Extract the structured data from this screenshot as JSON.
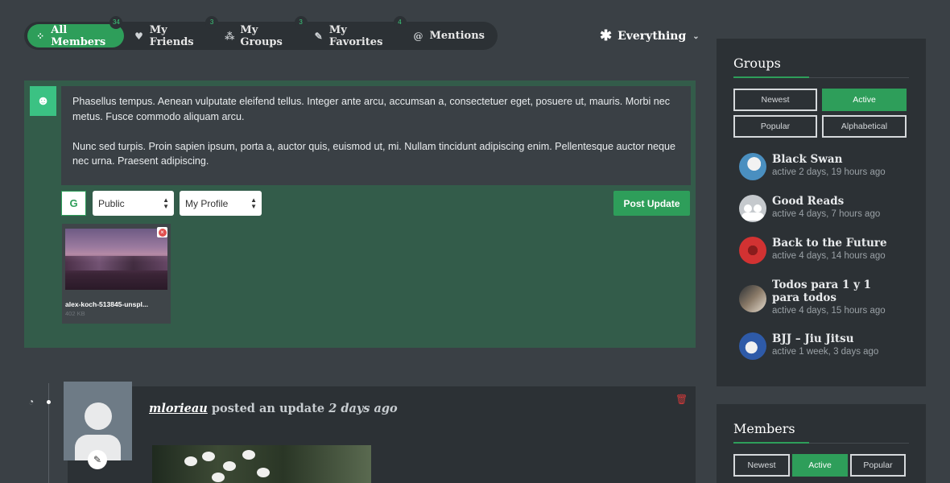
{
  "nav": {
    "tabs": [
      {
        "label": "All Members",
        "count": "34",
        "icon": "members-icon",
        "active": true
      },
      {
        "label": "My Friends",
        "count": "3",
        "icon": "heart-icon"
      },
      {
        "label": "My Groups",
        "count": "3",
        "icon": "groups-icon"
      },
      {
        "label": "My Favorites",
        "count": "4",
        "icon": "pin-icon"
      },
      {
        "label": "Mentions",
        "icon": "at-icon"
      }
    ],
    "scope_label": "Everything"
  },
  "composer": {
    "paragraphs": [
      "Phasellus tempus. Aenean vulputate eleifend tellus. Integer ante arcu, accumsan a, consectetuer eget, posuere ut, mauris. Morbi nec metus. Fusce commodo aliquam arcu.",
      "Nunc sed turpis. Proin sapien ipsum, porta a, auctor quis, euismod ut, mi. Nullam tincidunt adipiscing enim. Pellentesque auctor neque nec urna. Praesent adipiscing."
    ],
    "visibility": "Public",
    "post_in": "My Profile",
    "post_button": "Post Update",
    "attachment": {
      "filename": "alex-koch-513845-unspl...",
      "size": "402 KB"
    }
  },
  "activity": {
    "user": "mlorieau",
    "action": "posted an update",
    "time": "2 days ago"
  },
  "sidebar": {
    "groups": {
      "title": "Groups",
      "filters": [
        "Newest",
        "Active",
        "Popular",
        "Alphabetical"
      ],
      "active_filter": "Active",
      "items": [
        {
          "name": "Black Swan",
          "active": "active 2 days, 19 hours ago"
        },
        {
          "name": "Good Reads",
          "active": "active 4 days, 7 hours ago"
        },
        {
          "name": "Back to the Future",
          "active": "active 4 days, 14 hours ago"
        },
        {
          "name": "Todos para 1 y 1 para todos",
          "active": "active 4 days, 15 hours ago"
        },
        {
          "name": "BJJ – Jiu Jitsu",
          "active": "active 1 week, 3 days ago"
        }
      ]
    },
    "members": {
      "title": "Members",
      "filters": [
        "Newest",
        "Active",
        "Popular"
      ],
      "active_filter": "Active"
    }
  },
  "colors": {
    "accent": "#2e9e5a",
    "background": "#3a4045",
    "panel": "#2c3135",
    "composer": "#335c4a"
  }
}
